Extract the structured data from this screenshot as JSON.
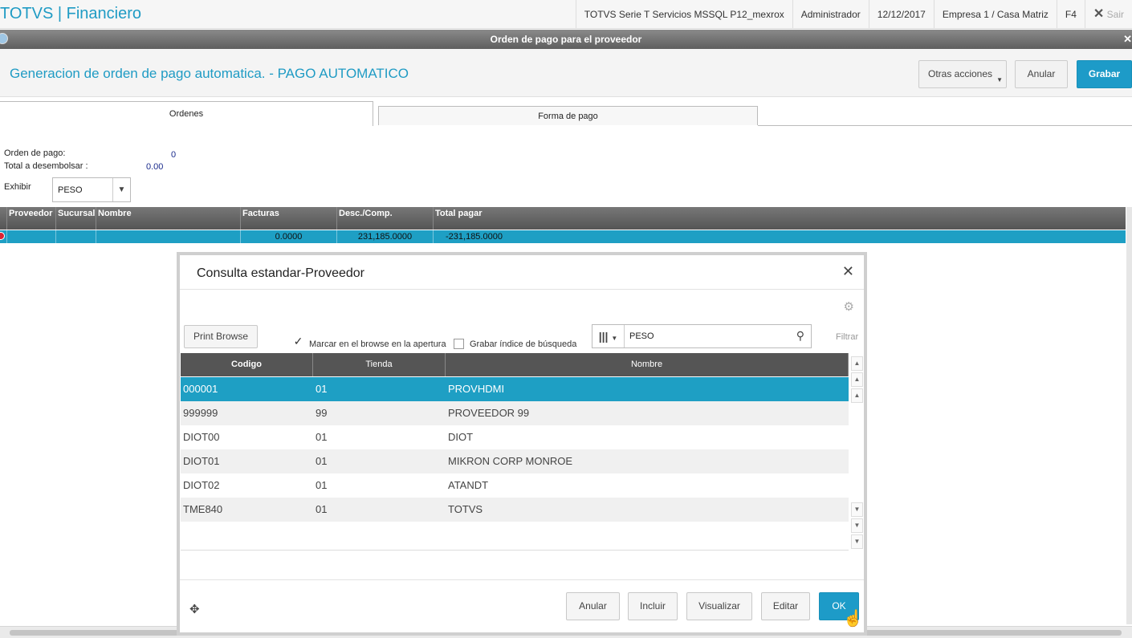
{
  "topbar": {
    "brand": "TOTVS | Financiero",
    "environment": "TOTVS Serie T Servicios MSSQL P12_mexrox",
    "user": "Administrador",
    "date": "12/12/2017",
    "company": "Empresa 1 / Casa Matriz",
    "shortcut": "F4",
    "close_glyph": "✕",
    "exit_label": "Sair"
  },
  "window": {
    "title": "Orden de pago para el proveedor",
    "close_glyph": "✕"
  },
  "header": {
    "title": "Generacion de orden de pago automatica. - PAGO AUTOMATICO",
    "other_actions_label": "Otras acciones",
    "cancel_label": "Anular",
    "save_label": "Grabar"
  },
  "tabs": [
    {
      "label": "Ordenes",
      "active": true
    },
    {
      "label": "Forma de pago",
      "active": false
    }
  ],
  "form": {
    "order_label": "Orden de pago:",
    "order_value": "0",
    "total_label": "Total a desembolsar :",
    "total_value": "0.00",
    "show_label": "Exhibir",
    "show_value": "PESO"
  },
  "grid": {
    "columns": [
      "Proveedor",
      "Sucursal",
      "Nombre",
      "Facturas",
      "Desc./Comp.",
      "Total pagar"
    ],
    "row": {
      "proveedor": "",
      "sucursal": "",
      "nombre": "",
      "facturas": "0.0000",
      "desc": "231,185.0000",
      "total": "-231,185.0000"
    }
  },
  "modal": {
    "title": "Consulta estandar-Proveedor",
    "close_glyph": "✕",
    "print_browse_label": "Print Browse",
    "mark_checkbox_label": "Marcar en el browse en la apertura",
    "mark_checked": true,
    "save_index_label": "Grabar índice de búsqueda",
    "save_index_checked": false,
    "search_value": "PESO",
    "filter_label": "Filtrar",
    "columns": [
      "Codigo",
      "Tienda",
      "Nombre"
    ],
    "rows": [
      {
        "codigo": "000001",
        "tienda": "01",
        "nombre": "PROVHDMI",
        "selected": true
      },
      {
        "codigo": "999999",
        "tienda": "99",
        "nombre": "PROVEEDOR 99",
        "selected": false
      },
      {
        "codigo": "DIOT00",
        "tienda": "01",
        "nombre": "DIOT",
        "selected": false
      },
      {
        "codigo": "DIOT01",
        "tienda": "01",
        "nombre": "MIKRON CORP MONROE",
        "selected": false
      },
      {
        "codigo": "DIOT02",
        "tienda": "01",
        "nombre": "ATANDT",
        "selected": false
      },
      {
        "codigo": "TME840",
        "tienda": "01",
        "nombre": "TOTVS",
        "selected": false
      }
    ],
    "buttons": {
      "cancel": "Anular",
      "include": "Incluir",
      "view": "Visualizar",
      "edit": "Editar",
      "ok": "OK"
    }
  },
  "icons": {
    "check": "✓",
    "columns": "|||",
    "search": "⚲",
    "gear": "⚙",
    "move": "✥",
    "dropdown": "▼",
    "scroll_up": "▲",
    "scroll_down": "▼",
    "pointer": "☝"
  },
  "colors": {
    "accent": "#1f9bc4",
    "selected_row": "#1e9fc4",
    "grid_header": "#555555"
  }
}
